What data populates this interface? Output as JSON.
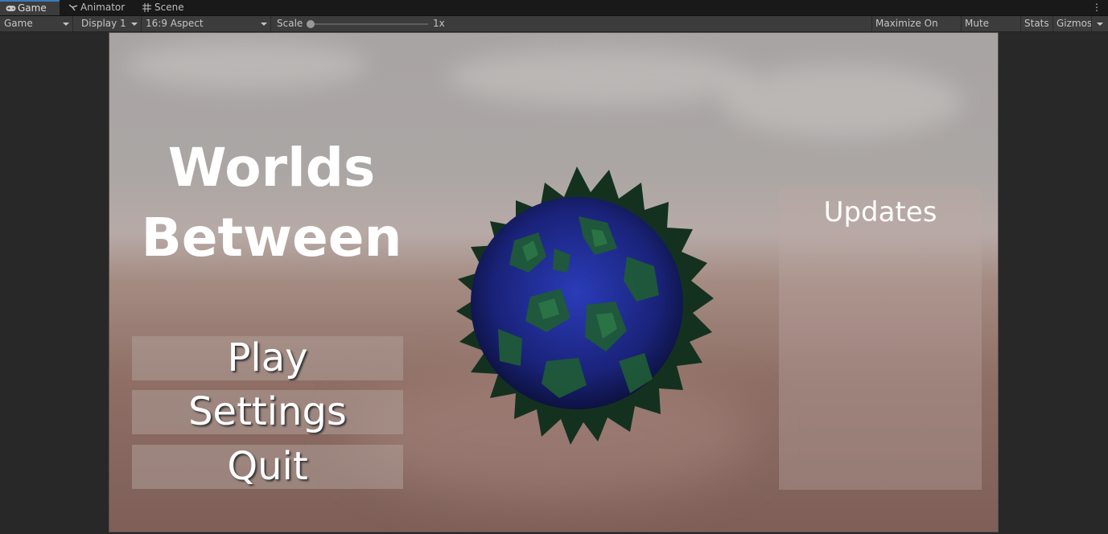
{
  "tabs": [
    {
      "label": "Game",
      "icon": "gamepad-icon",
      "active": true
    },
    {
      "label": "Animator",
      "icon": "animator-icon",
      "active": false
    },
    {
      "label": "Scene",
      "icon": "grid-icon",
      "active": false
    }
  ],
  "toolbar": {
    "view_mode": "Game",
    "display": "Display 1",
    "aspect": "16:9 Aspect",
    "scale_label": "Scale",
    "scale_value": "1x",
    "maximize_on_play": "Maximize On Play",
    "mute_audio": "Mute Audio",
    "stats": "Stats",
    "gizmos": "Gizmos"
  },
  "game": {
    "title_line1": "Worlds",
    "title_line2": "Between",
    "menu": {
      "play": "Play",
      "settings": "Settings",
      "quit": "Quit"
    },
    "updates_title": "Updates"
  },
  "colors": {
    "tab_accent": "#3a79bb",
    "editor_bg": "#282828",
    "planet_ocean": "#1c2a8a",
    "planet_land": "#1e5a34"
  }
}
